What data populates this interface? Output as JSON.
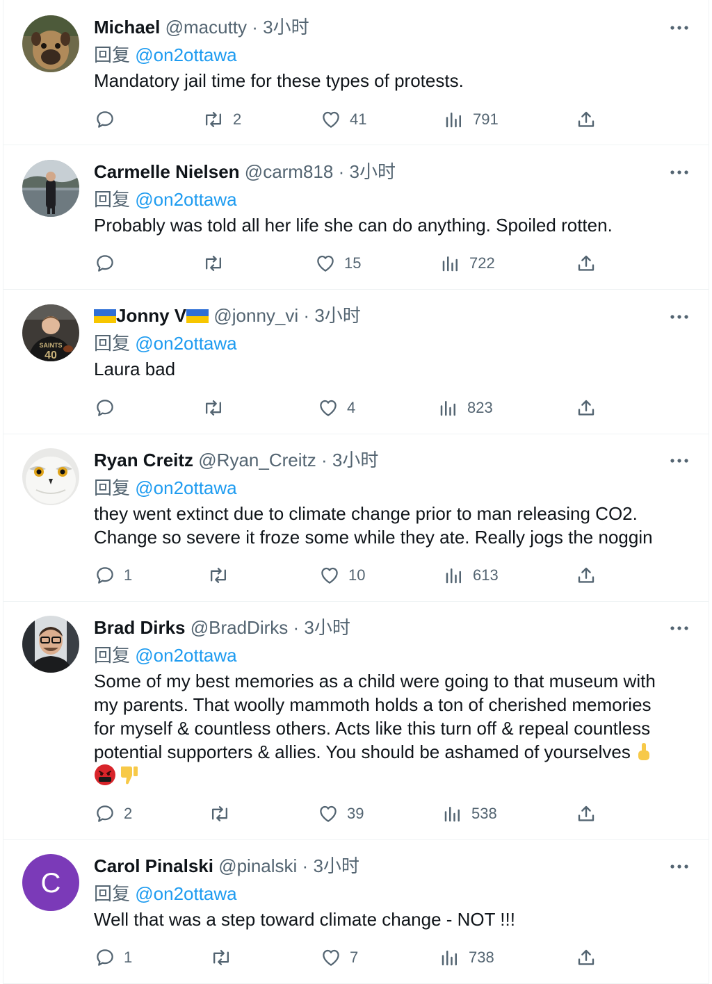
{
  "reply_prefix": "回复",
  "tweets": [
    {
      "name": "Michael",
      "handle": "@macutty",
      "time": "3小时",
      "mention": "@on2ottawa",
      "text": "Mandatory jail time for these types of protests.",
      "replies": "",
      "retweets": "2",
      "likes": "41",
      "views": "791",
      "avatar": "dog-photo"
    },
    {
      "name": "Carmelle Nielsen",
      "handle": "@carm818",
      "time": "3小时",
      "mention": "@on2ottawa",
      "text": "Probably was told all her life she can do anything. Spoiled rotten.",
      "replies": "",
      "retweets": "",
      "likes": "15",
      "views": "722",
      "avatar": "woman-lakeside-photo"
    },
    {
      "name": "Jonny V",
      "handle": "@jonny_vi",
      "time": "3小时",
      "mention": "@on2ottawa",
      "text": "Laura bad",
      "replies": "",
      "retweets": "",
      "likes": "4",
      "views": "823",
      "avatar": "boy-saints-jersey-photo",
      "avatar_text": "SAINTS 40",
      "name_flags": "ukraine-flag"
    },
    {
      "name": "Ryan Creitz",
      "handle": "@Ryan_Creitz",
      "time": "3小时",
      "mention": "@on2ottawa",
      "text": "they went extinct due to climate change prior to man releasing CO2.\nChange so severe it froze some while they ate. Really jogs the noggin",
      "replies": "1",
      "retweets": "",
      "likes": "10",
      "views": "613",
      "avatar": "snowy-owl-photo"
    },
    {
      "name": "Brad Dirks",
      "handle": "@BradDirks",
      "time": "3小时",
      "mention": "@on2ottawa",
      "text": "Some of my best memories as a child were going to that museum with\nmy parents. That woolly mammoth holds a ton of cherished memories\nfor myself & countless others. Acts like this turn off & repeal countless\npotential supporters & allies. You should be ashamed of yourselves ",
      "text_emojis": [
        "middle-finger-emoji",
        "cursing-face-emoji",
        "thumbs-down-emoji"
      ],
      "replies": "2",
      "retweets": "",
      "likes": "39",
      "views": "538",
      "avatar": "man-glasses-photo"
    },
    {
      "name": "Carol Pinalski",
      "handle": "@pinalski",
      "time": "3小时",
      "mention": "@on2ottawa",
      "text": "Well that was a step toward climate change - NOT !!!",
      "replies": "1",
      "retweets": "",
      "likes": "7",
      "views": "738",
      "avatar_letter": "C",
      "avatar_color": "#7b3ab8"
    }
  ],
  "colors": {
    "text": "#0f1419",
    "secondary": "#536471",
    "link": "#1d9bf0",
    "divider": "#eff3f4"
  }
}
